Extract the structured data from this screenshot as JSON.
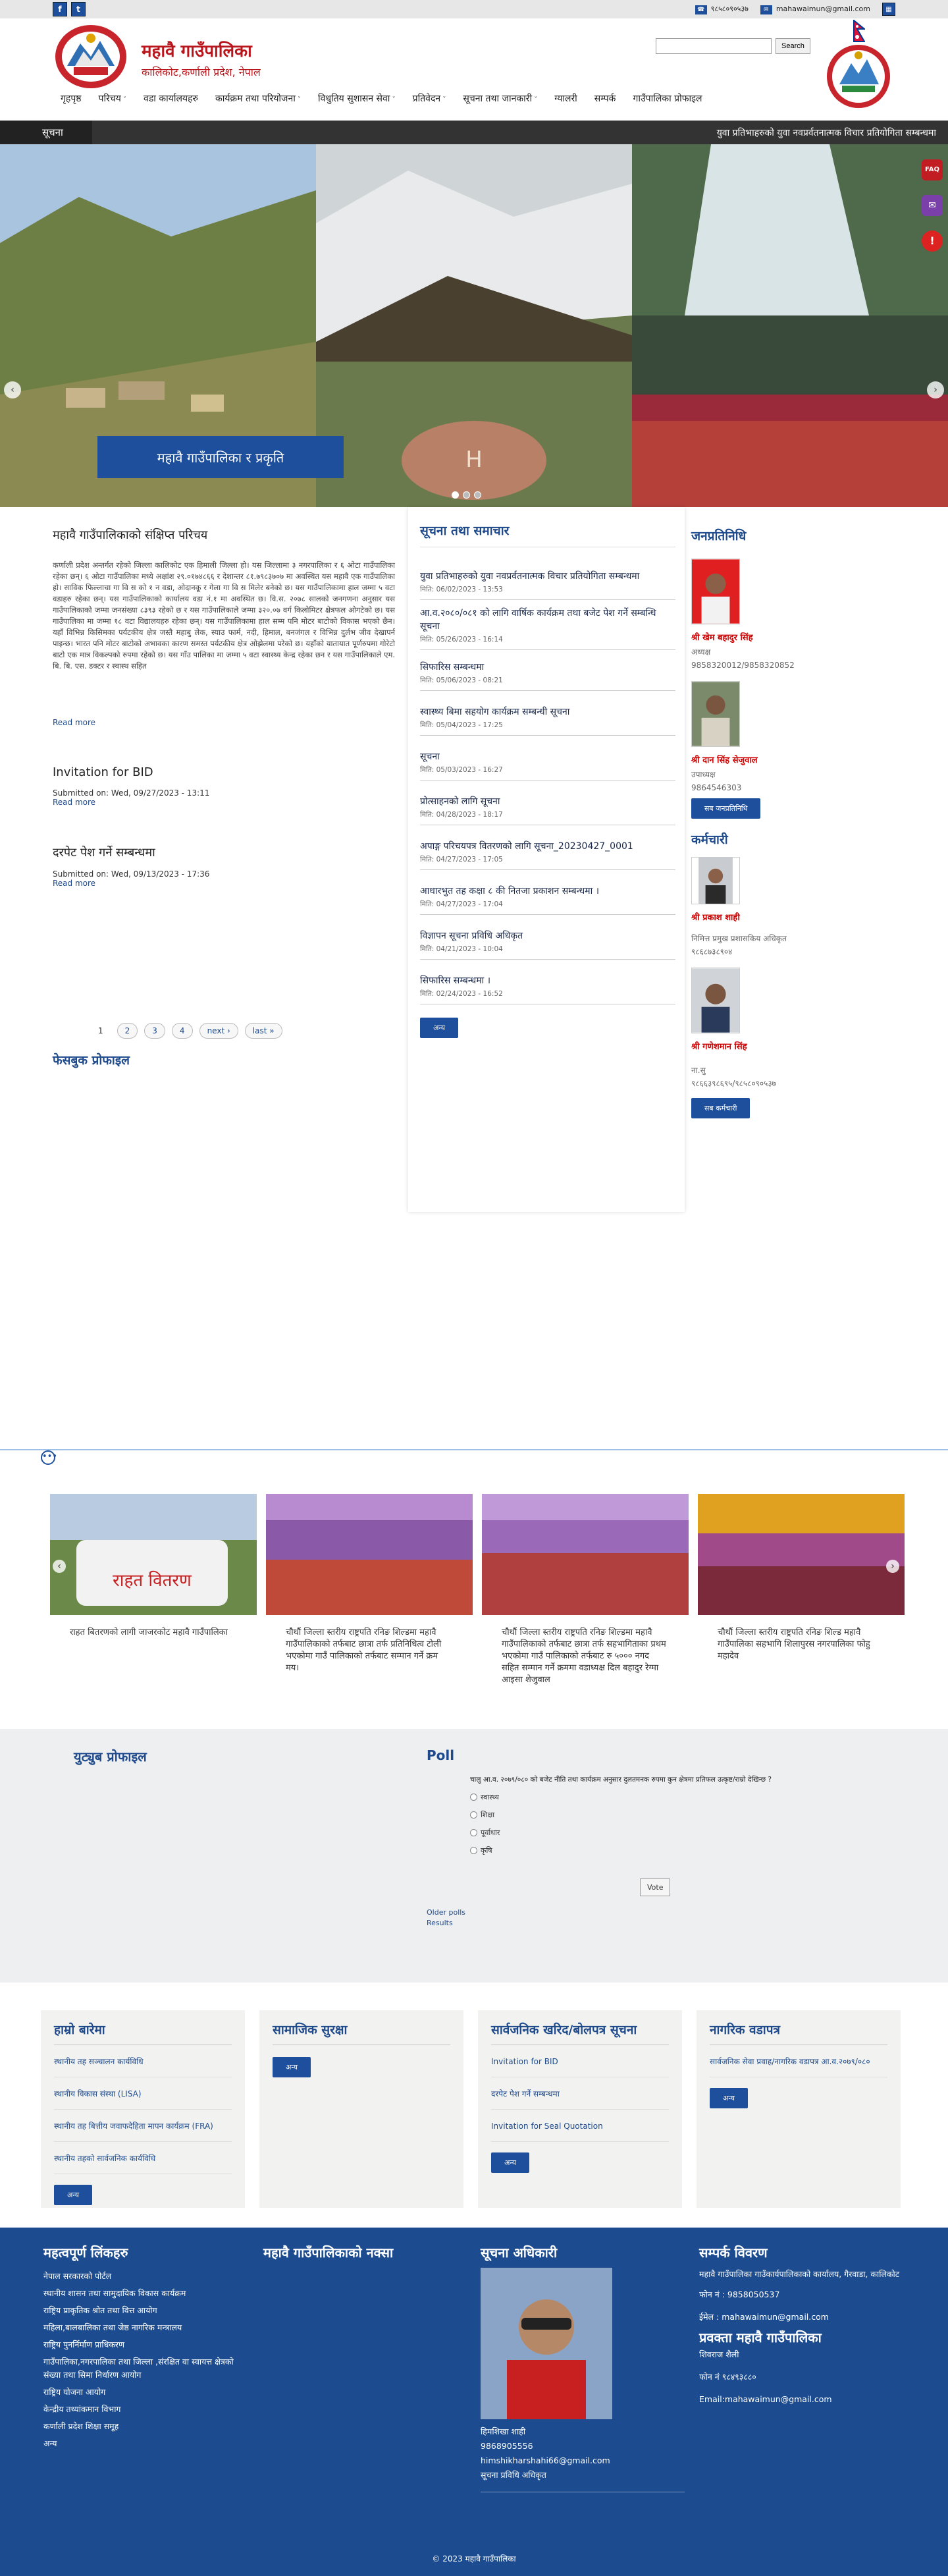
{
  "topbar": {
    "facebook_icon": "f",
    "twitter_icon": "t",
    "phone": "९८५८०९०५३७",
    "email": "mahawaimun@gmail.com"
  },
  "header": {
    "name": "महावै गाउँपालिका",
    "address": "कालिकोट,कर्णाली प्रदेश, नेपाल",
    "search_placeholder": "",
    "search_button": "Search"
  },
  "nav": [
    {
      "label": "गृहपृष्ठ",
      "dd": false
    },
    {
      "label": "परिचय",
      "dd": true
    },
    {
      "label": "वडा कार्यालयहरु",
      "dd": false
    },
    {
      "label": "कार्यक्रम तथा परियोजना",
      "dd": true
    },
    {
      "label": "विधुतिय सुशासन सेवा",
      "dd": true
    },
    {
      "label": "प्रतिवेदन",
      "dd": true
    },
    {
      "label": "सूचना तथा जानकारी",
      "dd": true
    },
    {
      "label": "ग्यालरी",
      "dd": false
    },
    {
      "label": "सम्पर्क",
      "dd": false
    },
    {
      "label": "गाउँपालिका प्रोफाइल",
      "dd": false
    }
  ],
  "notice": {
    "label": "सूचना",
    "marquee": "युवा प्रतिभाहरुको युवा नवप्रर्वतनात्मक विचार प्रतियोगिता सम्बन्धमा"
  },
  "slider": {
    "caption": "महावै गाउँपालिका र प्रकृति",
    "prev": "‹",
    "next": "›"
  },
  "sidetabs": [
    "FAQ",
    "✉",
    "!"
  ],
  "intro": {
    "title": "महावै गाउँपालिकाको संक्षिप्त परिचय",
    "body": "कर्णाली प्रदेश अन्तर्गत रहेको जिल्ला कालिकोट एक हिमाली जिल्ला हो। यस जिल्लामा ३ नगरपालिका र ६ ओटा गाउँपालिका रहेका छन्। ६ ओटा गाउँपालिका मध्ये अक्षांश २९.०१७४८६६ र देशान्तर ८१.७९८३७०७ मा अवस्थित यस महावै एक गाउँपालिका हो। साविक फिल्लाचा गा वि स को १ न वडा, ओदानकू र गेला गा वि स मिलेर बनेको छ। यस गाउँपालिकामा हाल जम्मा ५ वटा वडाहरु रहेका छन्। यस गाउँपालिकाको कार्यालय वडा नं.१ मा अवस्थित छ। वि.स. २०७८ सालको जनगणना अनुसार यस गाउँपालिकाको जम्मा जनसंख्या ८३९३ रहेको छ र यस गाउँपालिकाले जम्मा ३२०.०७ वर्ग किलोमिटर क्षेत्रफल ओगटेको छ। यस गाउँपालिका मा जम्मा १८ वटा विद्यालयहरु रहेका छन्। यस गाउँपालिकामा हाल सम्म पनि मोटर बाटोको विकास भएको छैन। यहाँ विभिन्न किसिमका पर्यटकीय क्षेत्र जस्तै महाबु लेक, स्याउ फार्म, नदी, हिमाल, बनजंगल र विभिन्न दुर्लभ जीव देखापर्न पाइन्छ। भारत पनि मोटर बाटोको अभावका कारण समस्त पर्यटकीय क्षेत्र ओझेलमा परेको छ। यहाँको यातायात पूर्णरुपमा गोरेटो बाटो एक मात्र विकल्पको रुपमा रहेको छ। यस गाँउ पालिका मा जम्मा ५ वटा स्वास्थ्य केन्द्र रहेका छन र यस गाउँपालिकाले एम. बि. बि. एस. डक्टर र स्वास्थ सहित",
    "read_more": "Read more"
  },
  "posts": [
    {
      "title": "Invitation for BID",
      "meta": "Submitted on: Wed, 09/27/2023 - 13:11",
      "read_more": "Read more"
    },
    {
      "title": "दरपेट पेश गर्ने सम्बन्धमा",
      "meta": "Submitted on: Wed, 09/13/2023 - 17:36",
      "read_more": "Read more"
    }
  ],
  "pagination": [
    "1",
    "2",
    "3",
    "4",
    "next ›",
    "last »"
  ],
  "facebook_title": "फेसबुक प्रोफाइल",
  "news": {
    "title": "सूचना तथा समाचार",
    "items": [
      {
        "t": "युवा प्रतिभाहरुको युवा नवप्रर्वतनात्मक विचार प्रतियोगिता सम्बन्धमा",
        "d": "मिति: 06/02/2023 - 13:53"
      },
      {
        "t": "आ.व.२०८०/०८१ को लागि वार्षिक कार्यक्रम तथा बजेट पेश गर्ने सम्बन्धि सूचना",
        "d": "मिति: 05/26/2023 - 16:14"
      },
      {
        "t": "सिफारिस सम्बन्धमा",
        "d": "मिति: 05/06/2023 - 08:21"
      },
      {
        "t": "स्वास्थ्य बिमा सहयोग कार्यक्रम सम्बन्धी सूचना",
        "d": "मिति: 05/04/2023 - 17:25"
      },
      {
        "t": "सूचना",
        "d": "मिति: 05/03/2023 - 16:27"
      },
      {
        "t": "प्रोत्साहनको लागि सूचना",
        "d": "मिति: 04/28/2023 - 18:17"
      },
      {
        "t": "अपाङ्ग परिचयपत्र वितरणको लागि सूचना_20230427_0001",
        "d": "मिति: 04/27/2023 - 17:05"
      },
      {
        "t": "आधारभुत तह कक्षा ८ की नितजा प्रकाशन सम्बन्धमा ।",
        "d": "मिति: 04/27/2023 - 17:04"
      },
      {
        "t": "विज्ञापन सूचना प्रविधि अधिकृत",
        "d": "मिति: 04/21/2023 - 10:04"
      },
      {
        "t": "सिफारिस सम्बन्धमा ।",
        "d": "मिति: 02/24/2023 - 16:52"
      }
    ],
    "more": "अन्य"
  },
  "reps": {
    "title": "जनप्रतिनिधि",
    "people": [
      {
        "name": "श्री खेम बहादुर सिंह",
        "role": "अध्यक्ष",
        "phone": "9858320012/9858320852"
      },
      {
        "name": "श्री दान सिंह सेजुवाल",
        "role": "उपाध्यक्ष",
        "phone": "9864546303"
      }
    ],
    "btn": "सब जनप्रतिनिधि"
  },
  "staff": {
    "title": "कर्मचारी",
    "people": [
      {
        "name": "श्री प्रकाश शाही",
        "role": "निमित्त प्रमुख प्रशासकिय अधिकृत",
        "phone": "९८६८७३८९०४"
      },
      {
        "name": "श्री गणेशमान सिंह",
        "role": "ना.सु",
        "phone": "९८६६३९८६९५/९८५८०९०५३७"
      }
    ],
    "btn": "सब कर्मचारी"
  },
  "gallery": [
    {
      "caption": "राहत बितरणको लागी जाजरकोट महावै गाउँपालिका"
    },
    {
      "caption": "चौथौं जिल्ला स्तरीय राष्ट्रपति रनिङ शिल्डमा महावै गाउँपालिकाको तर्फबाट छात्रा तर्फ प्रतिनिधित्व टोली भएकोमा गाउँ पालिकाको तर्फबाट सम्मान गर्ने क्रम मय।"
    },
    {
      "caption": "चौथौं जिल्ला स्तरीय राष्ट्रपति रनिङ शिल्डमा महावै गाउँपालिकाको तर्फबाट छात्रा तर्फ सहभागिताका प्रथम भएकोमा गाउँ पालिकाको तर्फबाट रु ५००० नगद सहित सम्मान गर्ने क्रममा वडाध्यक्ष दिल बहादुर रेग्मा आइसा शेजुवाल"
    },
    {
      "caption": "चौथौं जिल्ला स्तरीय राष्ट्रपति रनिङ शिल्ड महावै गाउँपालिका सहभागि शिलापुरस नगरपालिका फोहु महादेव"
    }
  ],
  "gallery_prev": "‹",
  "gallery_next": "›",
  "youtube_title": "युट्युब प्रोफाइल",
  "poll": {
    "title": "Poll",
    "question": "चालु आ.व. २०७९/०८० को बजेट नीति तथा कार्यक्रम अनुसार दुलतमनक रुपमा कुन क्षेत्रमा प्रतिफल उत्कृष्ट/राम्रो देखिन्छ ?",
    "options": [
      "स्वास्थ्य",
      "शिक्षा",
      "पूर्वाधार",
      "कृषि"
    ],
    "vote": "Vote",
    "older": "Older polls",
    "results": "Results"
  },
  "boxes": [
    {
      "title": "हाम्रो बारेमा",
      "items": [
        "स्थानीय तह सञ्चालन कार्यविधि",
        "स्थानीय विकास संस्था (LISA)",
        "स्थानीय तह बित्तीय जवाफदेहिता मापन कार्यक्रम (FRA)",
        "स्थानीय तहको सार्वजनिक कार्यविधि"
      ],
      "btn": "अन्य"
    },
    {
      "title": "सामाजिक सुरक्षा",
      "items": [],
      "btn": "अन्य"
    },
    {
      "title": "सार्वजनिक खरिद/बोलपत्र सूचना",
      "items": [
        "Invitation for BID",
        "दरपेट पेश गर्ने सम्बन्धमा",
        "Invitation for Seal Quotation"
      ],
      "btn": "अन्य"
    },
    {
      "title": "नागरिक वडापत्र",
      "items": [
        "सार्वजनिक सेवा प्रवाह/नागरिक वडापत्र आ.व.२०७९/०८०"
      ],
      "btn": "अन्य"
    }
  ],
  "footer": {
    "links_title": "महत्वपूर्ण लिंकहरु",
    "links": [
      "नेपाल सरकारको पोर्टल",
      "स्थानीय शासन तथा सामुदायिक विकास कार्यक्रम",
      "राष्ट्रिय प्राकृतिक श्रोत तथा वित्त आयोग",
      "महिला,बालबालिका तथा जेष्ठ नागरिक मन्त्रालय",
      "राष्ट्रिय पुनर्निर्माण प्राधिकरण",
      "गाउँपालिका,नगरपालिका तथा जिल्ला ,संरक्षित वा स्वायत्त क्षेत्रको संख्या तथा सिमा निर्धारण आयोग",
      "राष्ट्रिय योजना आयोग",
      "केन्द्रीय तथ्यांकमान विभाग",
      "कर्णाली प्रदेश  शिक्षा समूह",
      "अन्य"
    ],
    "map_title": "महावै गाउँपालिकाको नक्सा",
    "info_title": "सूचना अधिकारी",
    "info": [
      "हिमशिखा शाही",
      "9868905556",
      "himshikharshahi66@gmail.com",
      "सूचना प्रविधि अधिकृत"
    ],
    "contact_title": "सम्पर्क विवरण",
    "contact": [
      "महावै गाउँपालिका गाउँकार्यपालिकाको कार्यालय, गैरवाडा, कालिकोट",
      "फोन नं : 9858050537",
      "ईमेल : mahawaimun@gmail.com"
    ],
    "spokes_title": "प्रवक्ता महावै गाउँपालिका",
    "spokes": [
      "शिवराज शैली",
      "फोन नं ९८४९३८८०",
      "Email:mahawaimun@gmail.com"
    ],
    "copyright": "© 2023 महावै गाउँपालिका"
  }
}
